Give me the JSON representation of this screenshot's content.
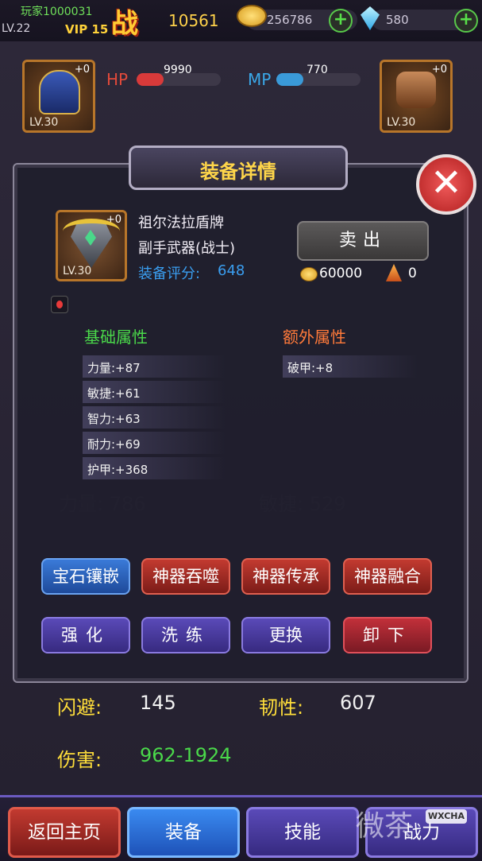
{
  "header": {
    "player_name": "玩家1000031",
    "level": "LV.22",
    "vip": "VIP 15",
    "power_icon": "战",
    "power_value": "10561",
    "gold": "256786",
    "gems": "580",
    "plus_symbol": "+"
  },
  "hero": {
    "hp_label": "HP",
    "hp_value": "9990",
    "mp_label": "MP",
    "mp_value": "770",
    "helmet_level": "LV.30",
    "helmet_plus": "+0",
    "gloves_level": "LV.30",
    "gloves_plus": "+0"
  },
  "bottom_stats": {
    "dodge_label": "闪避:",
    "dodge_value": "145",
    "toughness_label": "韧性:",
    "toughness_value": "607",
    "damage_label": "伤害:",
    "damage_value": "962-1924"
  },
  "dialog": {
    "title": "装备详情",
    "close_symbol": "✕",
    "item": {
      "name": "祖尔法拉盾牌",
      "type": "副手武器(战士)",
      "score_label": "装备评分:",
      "score": "648",
      "level": "LV.30",
      "plus": "+0"
    },
    "sell_label": "卖出",
    "sell_price": "60000",
    "shard_count": "0",
    "base_attr_title": "基础属性",
    "extra_attr_title": "额外属性",
    "base_attrs": [
      "力量:+87",
      "敏捷:+61",
      "智力:+63",
      "耐力:+69",
      "护甲:+368"
    ],
    "extra_attrs": [
      "破甲:+8"
    ],
    "buttons_row1": [
      "宝石镶嵌",
      "神器吞噬",
      "神器传承",
      "神器融合"
    ],
    "buttons_row2": [
      "强化",
      "洗练",
      "更换",
      "卸下"
    ]
  },
  "nav": {
    "home": "返回主页",
    "equipment": "装备",
    "skills": "技能",
    "battle": "战力"
  },
  "watermark": {
    "text": "微茶",
    "tag": "WXCHA"
  },
  "colors": {
    "accent_gold": "#ffd64a",
    "hp_red": "#e24a3a",
    "mp_blue": "#3aa8e8",
    "attr_green": "#4ad84a",
    "attr_orange": "#ff7a3a"
  }
}
